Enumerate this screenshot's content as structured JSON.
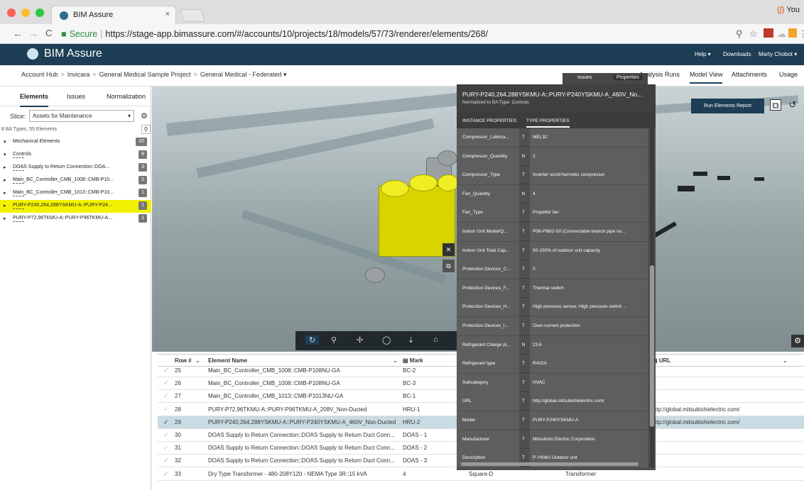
{
  "browser": {
    "tab_title": "BIM Assure",
    "tab_close": "×",
    "profile": "You",
    "profile_icon": "(∫)",
    "url_secure_label": "Secure",
    "url": "https://stage-app.bimassure.com/#/accounts/10/projects/18/models/57/73/renderer/elements/268/",
    "back": "←",
    "forward": "→",
    "reload": "C"
  },
  "app": {
    "brand": "BIM Assure",
    "nav": {
      "help": "Help ▾",
      "downloads": "Downloads",
      "user": "Marty Chobot ▾"
    }
  },
  "breadcrumb": [
    "Account Hub",
    "Invicara",
    "General Medical Sample Project",
    "General Medical - Federated ▾"
  ],
  "main_tabs": {
    "analysis": "Analysis Runs",
    "model": "Model View",
    "attachments": "Attachments",
    "usage": "Usage"
  },
  "sidebar": {
    "tabs": {
      "elements": "Elements",
      "issues": "Issues",
      "normalization": "Normalization"
    },
    "slice_label": "Slice:",
    "slice_value": "Assets for Maintenance",
    "type_count": "8 BA Types, 55 Elements",
    "tree": [
      {
        "label": "Mechanical Elements",
        "badge": "20",
        "twisty": "▾",
        "dash": false,
        "highlight": false
      },
      {
        "label": "Controls",
        "badge": "8",
        "twisty": "▾",
        "dash": true,
        "highlight": false
      },
      {
        "label": "DOAS Supply to Return Connection::DOA...",
        "badge": "3",
        "twisty": "▸",
        "dash": true,
        "highlight": false
      },
      {
        "label": "Main_BC_Controller_CMB_1008::CMB-P10...",
        "badge": "2",
        "twisty": "▸",
        "dash": true,
        "highlight": false
      },
      {
        "label": "Main_BC_Controller_CMB_1013::CMB-P10...",
        "badge": "1",
        "twisty": "▸",
        "dash": true,
        "highlight": false
      },
      {
        "label": "PURY-P240,264,288YSKMU-A::PURY-P24...",
        "badge": "1",
        "twisty": "▸",
        "dash": true,
        "highlight": true
      },
      {
        "label": "PURY-P72,96TKMU-A::PURY-P96TKMU-A...",
        "badge": "1",
        "twisty": "▸",
        "dash": true,
        "highlight": false
      }
    ]
  },
  "viewport": {
    "run_report": "Run Elements Report",
    "tools": [
      "↻",
      "⚲",
      "✢",
      "◯",
      "⇣",
      "⌂"
    ]
  },
  "panel": {
    "float_tabs": {
      "issues": "Issues",
      "properties": "Properties"
    },
    "title": "PURY-P240,264,288YSKMU-A::PURY-P240YSKMU-A_460V_No...",
    "subtitle": "Normalized to BA Type: Controls",
    "tabs": {
      "instance": "INSTANCE PROPERTIES",
      "type": "TYPE PROPERTIES"
    },
    "rows": [
      {
        "k": "Compressor_Lubrica...",
        "t": "T",
        "v": "MEL32"
      },
      {
        "k": "Compressor_Quantity",
        "t": "N",
        "v": "2"
      },
      {
        "k": "Compressor_Type",
        "t": "T",
        "v": "Inverter scroll hermetic compressor"
      },
      {
        "k": "Fan_Quantity",
        "t": "N",
        "v": "4"
      },
      {
        "k": "Fan_Type",
        "t": "T",
        "v": "Propeller fan"
      },
      {
        "k": "Indoor Unit Model/Q...",
        "t": "T",
        "v": "P06-P96/2-50 (Connectable branch pipe nu..."
      },
      {
        "k": "Indoor Unit Total Cap...",
        "t": "T",
        "v": "50-150% of outdoor unit capacity"
      },
      {
        "k": "Protection Devices_C...",
        "t": "T",
        "v": "0"
      },
      {
        "k": "Protection Devices_F...",
        "t": "T",
        "v": "Thermal switch"
      },
      {
        "k": "Protection Devices_H...",
        "t": "T",
        "v": "High pressure sensor, High pressure switch ..."
      },
      {
        "k": "Protection Devices_I...",
        "t": "T",
        "v": "Over-current protection"
      },
      {
        "k": "Refrigerant Charge (k...",
        "t": "N",
        "v": "23.6"
      },
      {
        "k": "Refrigerant type",
        "t": "T",
        "v": "R410A"
      },
      {
        "k": "Subcategory",
        "t": "T",
        "v": "HVAC"
      },
      {
        "k": "URL",
        "t": "T",
        "v": "http://global.mitsubishielectric.com/"
      },
      {
        "k": "Model",
        "t": "T",
        "v": "PURY-P240YSKMU-A"
      },
      {
        "k": "Manufacturer",
        "t": "T",
        "v": "Mitsubishi Electric Corporation"
      },
      {
        "k": "Description",
        "t": "T",
        "v": "P-YKMU Outdoor unit"
      }
    ]
  },
  "grid": {
    "headers": {
      "row": "Row #",
      "name": "Element Name",
      "mark": "Mark",
      "url": "URL"
    },
    "rows": [
      {
        "row": "25",
        "name": "Main_BC_Controller_CMB_1008::CMB-P108NU-GA",
        "mark": "BC-2",
        "url": "",
        "extra": "",
        "extra2": "",
        "selected": false
      },
      {
        "row": "26",
        "name": "Main_BC_Controller_CMB_1008::CMB-P108NU-GA",
        "mark": "BC-3",
        "url": "",
        "extra": "",
        "extra2": "",
        "selected": false
      },
      {
        "row": "27",
        "name": "Main_BC_Controller_CMB_1013::CMB-P1013NU-GA",
        "mark": "BC-1",
        "url": "",
        "extra": "",
        "extra2": "",
        "selected": false
      },
      {
        "row": "28",
        "name": "PURY-P72,96TKMU-A::PURY-P96TKMU-A_208V_Non-Ducted",
        "mark": "HRU-1",
        "url": "ttp://global.mitsubishielectric.com/",
        "extra": "",
        "extra2": "",
        "selected": false
      },
      {
        "row": "29",
        "name": "PURY-P240,264,288YSKMU-A::PURY-P240YSKMU-A_460V_Non-Ducted",
        "mark": "HRU-2",
        "url": "ttp://global.mitsubishielectric.com/",
        "extra": "",
        "extra2": "",
        "selected": true
      },
      {
        "row": "30",
        "name": "DOAS Supply to Return Connection::DOAS Supply to Return Duct Conn...",
        "mark": "DOAS - 1",
        "url": "",
        "extra": "",
        "extra2": "",
        "selected": false
      },
      {
        "row": "31",
        "name": "DOAS Supply to Return Connection::DOAS Supply to Return Duct Conn...",
        "mark": "DOAS - 2",
        "url": "",
        "extra": "",
        "extra2": "",
        "selected": false
      },
      {
        "row": "32",
        "name": "DOAS Supply to Return Connection::DOAS Supply to Return Duct Conn...",
        "mark": "DOAS - 3",
        "url": "",
        "extra": "",
        "extra2": "",
        "selected": false
      },
      {
        "row": "33",
        "name": "Dry Type Transformer - 480-208Y120 - NEMA Type 3R::15 kVA",
        "mark": "4",
        "url": "",
        "extra": "Square-D",
        "extra2": "Transformer",
        "selected": false
      }
    ]
  }
}
